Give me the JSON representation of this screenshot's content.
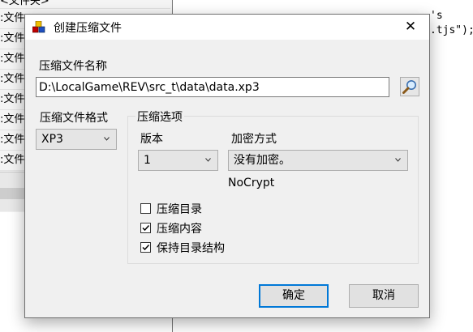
{
  "background": {
    "list_items": [
      "<文件夹>",
      ":文件",
      ":文件",
      ":文件",
      ":文件",
      ":文件",
      ":文件",
      ":文件",
      ":文件"
    ],
    "code_line1": "'s",
    "code_line2": ".tjs\");"
  },
  "dialog": {
    "title": "创建压缩文件",
    "close_glyph": "✕",
    "archive_name_label": "压缩文件名称",
    "archive_path": "D:\\LocalGame\\REV\\src_t\\data\\data.xp3",
    "format_label": "压缩文件格式",
    "format_value": "XP3",
    "options_group_label": "压缩选项",
    "version_label": "版本",
    "version_value": "1",
    "encryption_label": "加密方式",
    "encryption_value": "没有加密。",
    "crypt_name": "NoCrypt",
    "checkboxes": [
      {
        "label": "压缩目录",
        "checked": false
      },
      {
        "label": "压缩内容",
        "checked": true
      },
      {
        "label": "保持目录结构",
        "checked": true
      }
    ],
    "ok_label": "确定",
    "cancel_label": "取消"
  },
  "icons": {
    "app": "archive-icon",
    "browse": "magnifier-icon",
    "dropdown": "chevron-down-icon",
    "close": "close-icon"
  },
  "colors": {
    "dialog_bg": "#f0f0f0",
    "accent": "#0078d7"
  }
}
